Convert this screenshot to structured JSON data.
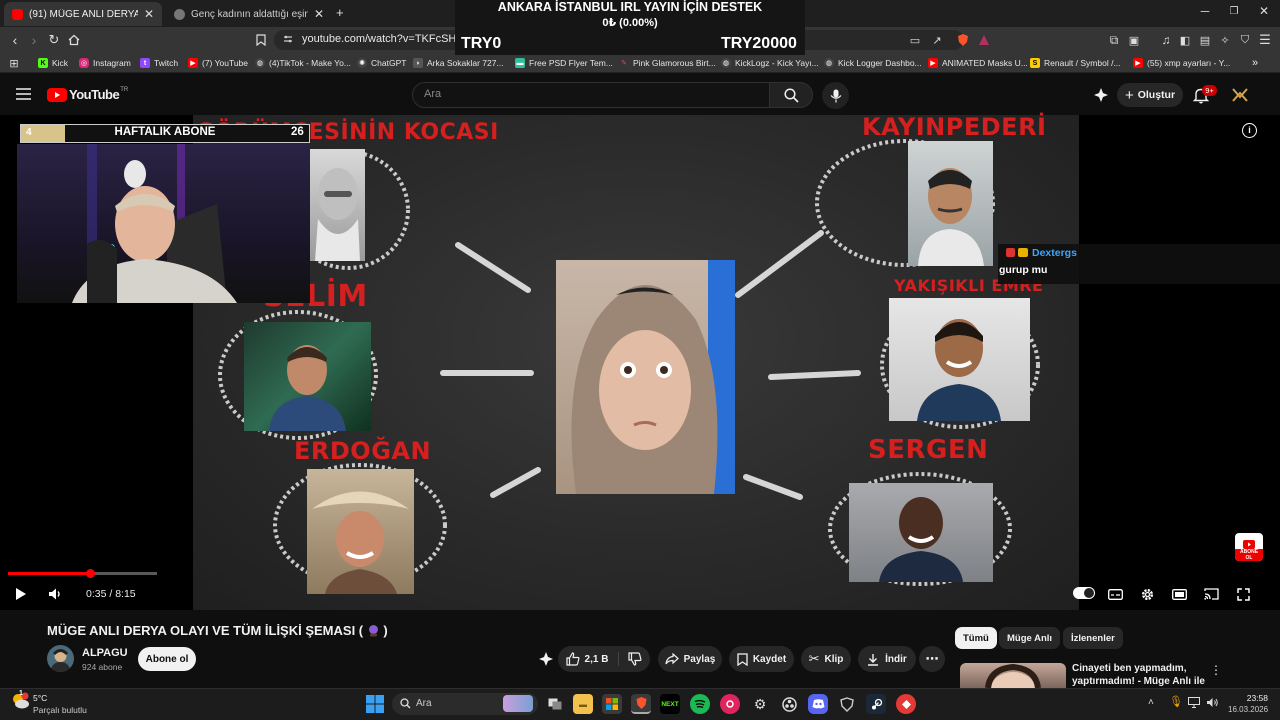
{
  "browser": {
    "tabs": [
      {
        "title": "(91) MÜGE ANLI DERYA OLAYI VE",
        "active": true
      },
      {
        "title": "Genç kadının aldattığı eşine attığı mu",
        "active": false
      }
    ],
    "new_tab": "+",
    "url": "youtube.com/watch?v=TKFcSHyJQGo",
    "bookmarks": [
      "Kick",
      "Instagram",
      "Twitch",
      "(7) YouTube",
      "(4)TikTok - Make Yo...",
      "ChatGPT",
      "Arka Sokaklar 727...",
      "Free PSD Flyer Tem...",
      "Pink Glamorous Birt...",
      "KickLogz - Kick Yayı...",
      "Kick Logger Dashbo...",
      "ANIMATED Masks U...",
      "Renault / Symbol /...",
      "(55) xmp ayarları - Y..."
    ],
    "bookmarks_more": "»"
  },
  "donation": {
    "title": "ANKARA İSTANBUL IRL YAYIN İÇİN DESTEK",
    "progress_text": "0₺ (0.00%)",
    "progress": 0,
    "min": "TRY0",
    "max": "TRY20000"
  },
  "youtube": {
    "logo": "YouTube",
    "logo_region": "TR",
    "search_placeholder": "Ara",
    "create_label": "Oluştur",
    "notifications": "9+"
  },
  "video": {
    "weekly_sub": {
      "title": "HAFTALIK ABONE",
      "current": "4",
      "goal": "26",
      "progress": 0.154
    },
    "diagram_labels": {
      "top_left": "GÖRÜMCESİNİN KOCASI",
      "top_right": "KAYINPEDERİ",
      "mid_left": "SELİM",
      "mid_right": "YAKIŞIKLI EMRE",
      "bottom_left": "ERDOĞAN",
      "bottom_right": "SERGEN"
    },
    "chat": {
      "user": "Dextergs",
      "message": "gurup mu"
    },
    "subscribe_badge": [
      "ABONE",
      "OL"
    ],
    "time_current": "0:35",
    "time_total": "8:15",
    "progress": 0.0707
  },
  "below": {
    "title": "MÜGE ANLI DERYA OLAYI VE TÜM İLİŞKİ ŞEMASI (",
    "title_suffix": ")",
    "channel": "ALPAGU",
    "subs": "924 abone",
    "subscribe": "Abone ol",
    "likes": "2,1 B",
    "share": "Paylaş",
    "save": "Kaydet",
    "clip": "Klip",
    "download": "İndir",
    "chips": [
      "Tümü",
      "Müge Anlı",
      "İzlenenler"
    ],
    "rec_title": "Cinayeti ben yapmadım, yaptırmadım! - Müge Anlı ile ..."
  },
  "taskbar": {
    "weather_temp": "5°C",
    "weather_desc": "Parçalı bulutlu",
    "search_placeholder": "Ara",
    "time": "23:58",
    "date": "16.03.2026",
    "badge_count": "1"
  },
  "colors": {
    "accent_red": "#ff0000",
    "chalk_red": "#d61f1f",
    "link_blue": "#3ea6ff"
  }
}
